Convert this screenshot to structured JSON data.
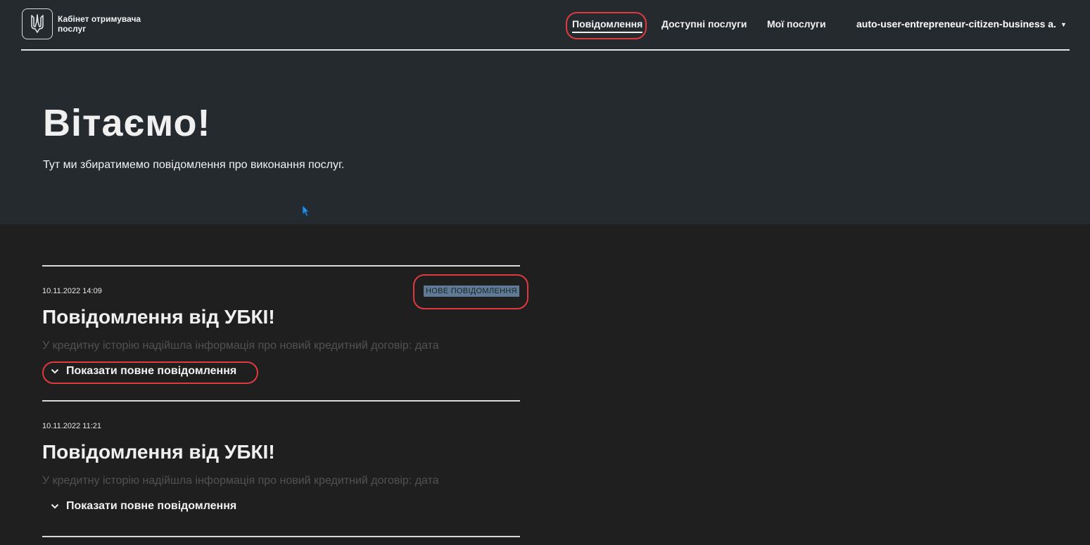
{
  "header": {
    "logo_text": "Кабінет отримувача послуг",
    "nav": [
      {
        "label": "Повідомлення",
        "active": true
      },
      {
        "label": "Доступні послуги",
        "active": false
      },
      {
        "label": "Мої послуги",
        "active": false
      }
    ],
    "user_menu": {
      "label": "auto-user-entrepreneur-citizen-business a."
    }
  },
  "hero": {
    "title": "Вітаємо!",
    "subtitle": "Тут ми збиратимемо повідомлення про виконання послуг."
  },
  "messages": [
    {
      "date": "10.11.2022 14:09",
      "badge": "НОВЕ ПОВІДОМЛЕННЯ",
      "title": "Повідомлення від УБКІ!",
      "body": "У кредитну історію надійшла інформація про новий кредитний договір: дата",
      "toggle": "Показати повне повідомлення"
    },
    {
      "date": "10.11.2022 11:21",
      "badge": "",
      "title": "Повідомлення від УБКІ!",
      "body": "У кредитну історію надійшла інформація про новий кредитний договір: дата",
      "toggle": "Показати повне повідомлення"
    }
  ],
  "colors": {
    "hero_bg": "#252a2e",
    "page_bg": "#1f1f1f",
    "highlight_ring": "#e0393e",
    "badge_bg": "#5e7a95"
  },
  "icons": [
    "trident-icon",
    "caret-down-icon",
    "chevron-down-icon",
    "mouse-cursor-icon"
  ]
}
